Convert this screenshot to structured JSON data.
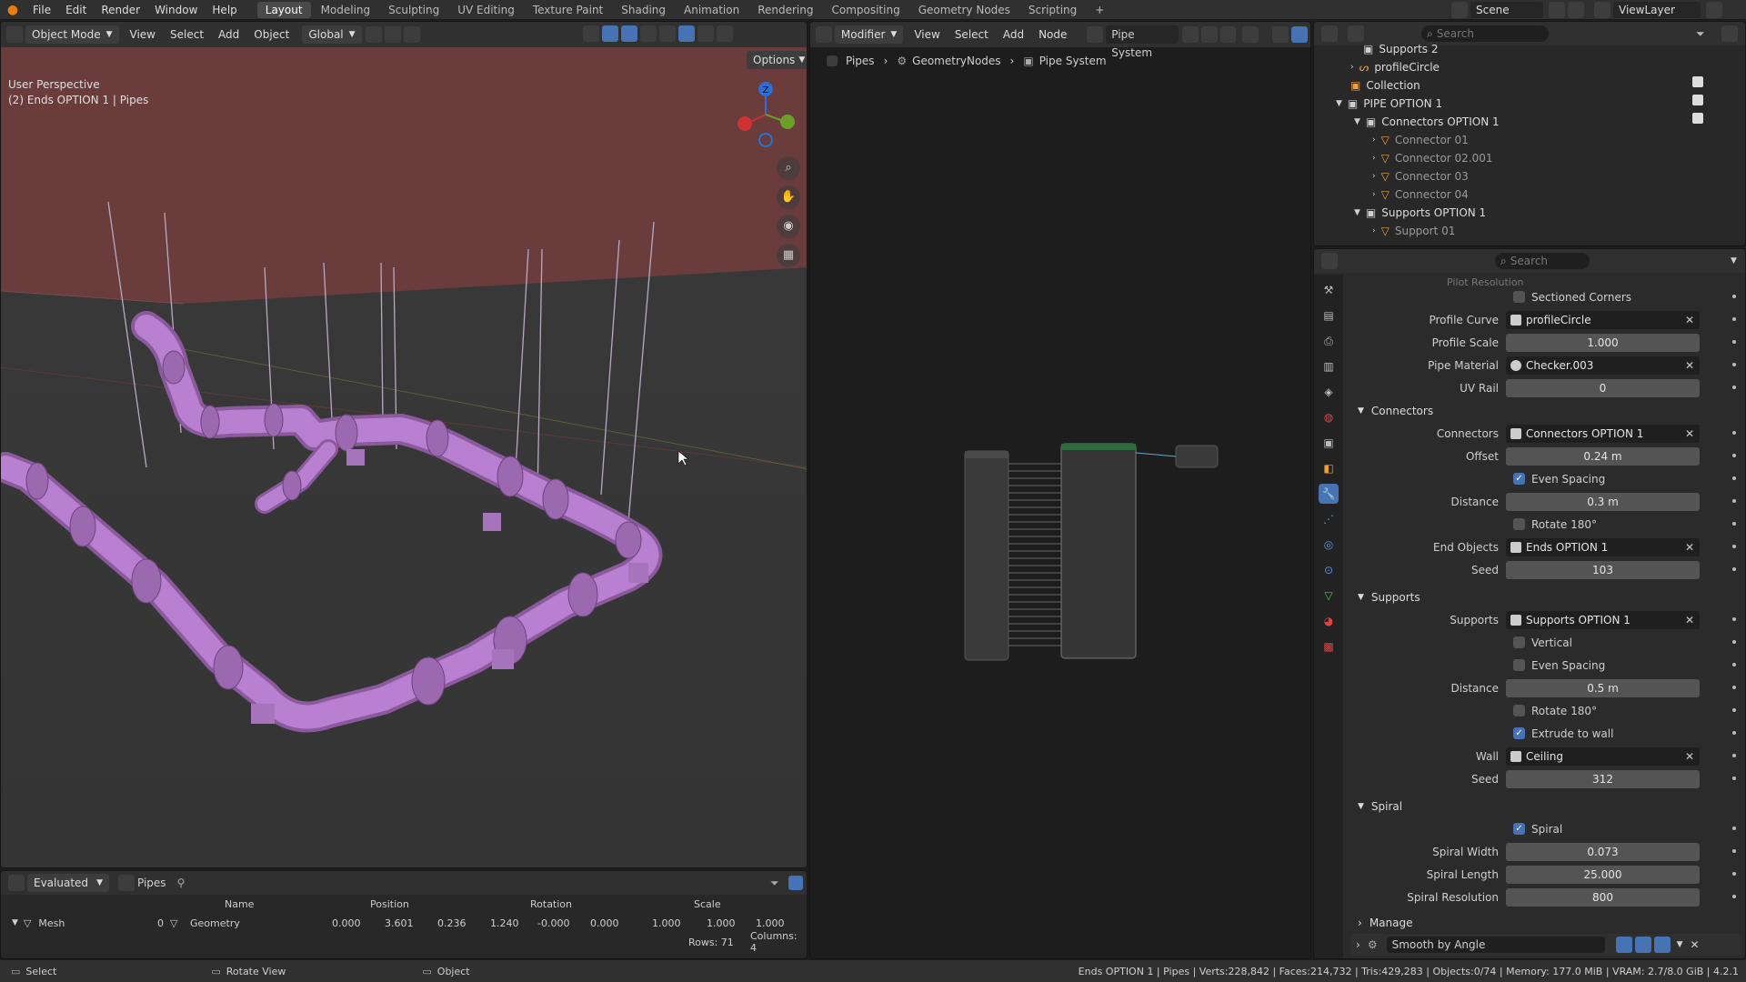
{
  "app": {
    "menus": [
      "File",
      "Edit",
      "Render",
      "Window",
      "Help"
    ]
  },
  "workspaces": [
    {
      "label": "Layout",
      "active": true
    },
    {
      "label": "Modeling"
    },
    {
      "label": "Sculpting"
    },
    {
      "label": "UV Editing"
    },
    {
      "label": "Texture Paint"
    },
    {
      "label": "Shading"
    },
    {
      "label": "Animation"
    },
    {
      "label": "Rendering"
    },
    {
      "label": "Compositing"
    },
    {
      "label": "Geometry Nodes"
    },
    {
      "label": "Scripting"
    }
  ],
  "topright": {
    "scene": "Scene",
    "view_layer": "ViewLayer",
    "add_tab": "+"
  },
  "viewport": {
    "mode": "Object Mode",
    "menus": [
      "View",
      "Select",
      "Add",
      "Object"
    ],
    "orientation": "Global",
    "options": "Options",
    "overlay_title": "User Perspective",
    "overlay_sub": "(2) Ends OPTION 1 | Pipes",
    "pipe_color": "#b97fd0",
    "gizmo": {
      "z": "Z",
      "y": "Y",
      "x": "X"
    }
  },
  "node_editor": {
    "type": "Modifier",
    "menus": [
      "View",
      "Select",
      "Add",
      "Node"
    ],
    "tree": "Pipe System",
    "breadcrumb": [
      "Pipes",
      "GeometryNodes",
      "Pipe System"
    ]
  },
  "outliner": {
    "search_placeholder": "Search",
    "rows": [
      {
        "label": "Supports 2",
        "level": 2
      },
      {
        "label": "profileCircle",
        "level": 2
      },
      {
        "label": "Collection",
        "level": 1
      },
      {
        "label": "PIPE OPTION 1",
        "level": 1
      },
      {
        "label": "Connectors OPTION 1",
        "level": 2
      },
      {
        "label": "Connector 01",
        "level": 3,
        "dim": true
      },
      {
        "label": "Connector 02.001",
        "level": 3,
        "dim": true
      },
      {
        "label": "Connector 03",
        "level": 3,
        "dim": true
      },
      {
        "label": "Connector 04",
        "level": 3,
        "dim": true
      },
      {
        "label": "Supports OPTION 1",
        "level": 2
      },
      {
        "label": "Support 01",
        "level": 3,
        "dim": true
      }
    ]
  },
  "properties": {
    "search_placeholder": "Search",
    "cutoff_label": "Pilot Resolution",
    "sectioned_corners": "Sectioned Corners",
    "profile_curve": {
      "label": "Profile Curve",
      "value": "profileCircle"
    },
    "profile_scale": {
      "label": "Profile Scale",
      "value": "1.000"
    },
    "pipe_material": {
      "label": "Pipe Material",
      "value": "Checker.003"
    },
    "uv_rail": {
      "label": "UV Rail",
      "value": "0"
    },
    "connectors_section": "Connectors",
    "connectors": {
      "label": "Connectors",
      "value": "Connectors OPTION 1"
    },
    "offset": {
      "label": "Offset",
      "value": "0.24 m"
    },
    "even_spacing": "Even Spacing",
    "distance_c": {
      "label": "Distance",
      "value": "0.3 m"
    },
    "rotate_c": "Rotate 180°",
    "end_objects": {
      "label": "End Objects",
      "value": "Ends OPTION 1"
    },
    "seed_c": {
      "label": "Seed",
      "value": "103"
    },
    "supports_section": "Supports",
    "supports": {
      "label": "Supports",
      "value": "Supports OPTION 1"
    },
    "vertical": "Vertical",
    "even_spacing_s": "Even Spacing",
    "distance_s": {
      "label": "Distance",
      "value": "0.5 m"
    },
    "rotate_s": "Rotate 180°",
    "extrude": "Extrude to wall",
    "wall": {
      "label": "Wall",
      "value": "Ceiling"
    },
    "seed_s": {
      "label": "Seed",
      "value": "312"
    },
    "spiral_section": "Spiral",
    "spiral": "Spiral",
    "spiral_width": {
      "label": "Spiral Width",
      "value": "0.073"
    },
    "spiral_length": {
      "label": "Spiral Length",
      "value": "25.000"
    },
    "spiral_res": {
      "label": "Spiral Resolution",
      "value": "800"
    },
    "manage_section": "Manage",
    "smooth": "Smooth by Angle"
  },
  "spreadsheet": {
    "evaluated": "Evaluated",
    "object": "Pipes",
    "columns": [
      "Name",
      "Position",
      "Rotation",
      "Scale"
    ],
    "tree": "Mesh",
    "row": {
      "index": "0",
      "name": "Geometry",
      "values": [
        "0.000",
        "3.601",
        "0.236",
        "1.240",
        "-0.000",
        "0.000",
        "1.000",
        "1.000",
        "1.000"
      ]
    },
    "rows_label": "Rows: 71",
    "cols_label": "Columns: 4"
  },
  "status": {
    "select": "Select",
    "rotate": "Rotate View",
    "object": "Object",
    "stats": "Ends OPTION 1 | Pipes | Verts:228,842 | Faces:214,732 | Tris:429,283 | Objects:0/74 | Memory: 177.0 MiB | VRAM: 2.7/8.0 GiB | 4.2.1"
  }
}
